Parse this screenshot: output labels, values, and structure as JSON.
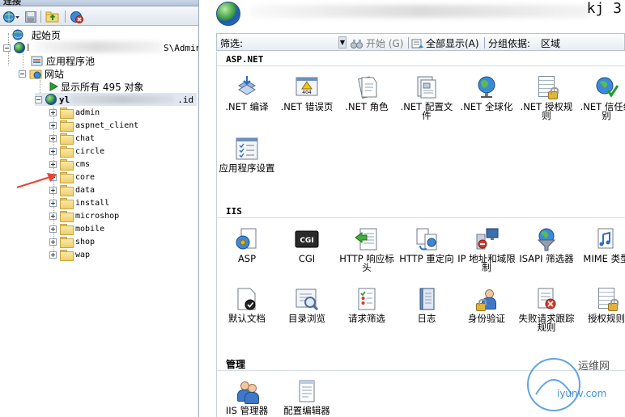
{
  "left_pane": {
    "header_title": "连接",
    "tree": {
      "start_page": "起始页",
      "server_suffix": "S\\Admin",
      "app_pools": "应用程序池",
      "sites": "网站",
      "show_all": "显示所有 495 对象",
      "site_prefix": "yl",
      "site_suffix": ".id",
      "folders": [
        "admin",
        "aspnet_client",
        "chat",
        "circle",
        "cms",
        "core",
        "data",
        "install",
        "microshop",
        "mobile",
        "shop",
        "wap"
      ]
    }
  },
  "right_pane": {
    "title_tail": "kj 3",
    "filter_bar": {
      "label": "筛选:",
      "go_label": "开始 (G)",
      "show_all_label": "全部显示(A)",
      "group_by_label": "分组依据:",
      "group_by_value": "区域"
    },
    "sections": [
      {
        "title": "ASP.NET",
        "features": [
          {
            "label": ".NET 编译",
            "icon": "dotnet-compile-icon"
          },
          {
            "label": ".NET 错误页",
            "icon": "error-pages-404-icon"
          },
          {
            "label": ".NET 角色",
            "icon": "roles-icon"
          },
          {
            "label": ".NET 配置文件",
            "icon": "profile-icon"
          },
          {
            "label": ".NET 全球化",
            "icon": "globalization-icon"
          },
          {
            "label": ".NET 授权规则",
            "icon": "authorization-rules-icon"
          },
          {
            "label": ".NET 信任级别",
            "icon": "trust-levels-icon"
          },
          {
            "label": "应用程序设置",
            "icon": "app-settings-icon"
          }
        ]
      },
      {
        "title": "IIS",
        "features": [
          {
            "label": "ASP",
            "icon": "asp-icon"
          },
          {
            "label": "CGI",
            "icon": "cgi-icon"
          },
          {
            "label": "HTTP 响应标头",
            "icon": "http-headers-icon"
          },
          {
            "label": "HTTP 重定向",
            "icon": "http-redirect-icon"
          },
          {
            "label": "IP 地址和域限制",
            "icon": "ip-restrictions-icon"
          },
          {
            "label": "ISAPI 筛选器",
            "icon": "isapi-filters-icon"
          },
          {
            "label": "MIME 类型",
            "icon": "mime-types-icon"
          },
          {
            "label": "默认文档",
            "icon": "default-document-icon"
          },
          {
            "label": "目录浏览",
            "icon": "directory-browsing-icon"
          },
          {
            "label": "请求筛选",
            "icon": "request-filtering-icon"
          },
          {
            "label": "日志",
            "icon": "logging-icon"
          },
          {
            "label": "身份验证",
            "icon": "authentication-icon"
          },
          {
            "label": "失败请求跟踪规则",
            "icon": "failed-request-tracing-icon"
          },
          {
            "label": "授权规则",
            "icon": "iis-authorization-icon"
          }
        ]
      },
      {
        "title": "管理",
        "features": [
          {
            "label": "IIS 管理器",
            "icon": "iis-manager-permissions-icon"
          },
          {
            "label": "配置编辑器",
            "icon": "configuration-editor-icon"
          }
        ]
      }
    ]
  },
  "watermark": {
    "brand": "运维网",
    "url": "iyunv.com"
  },
  "colors": {
    "accent_red": "#e8432e",
    "toolbar_border": "#a9b7c9",
    "folder_yellow": "#f0cf6a"
  }
}
